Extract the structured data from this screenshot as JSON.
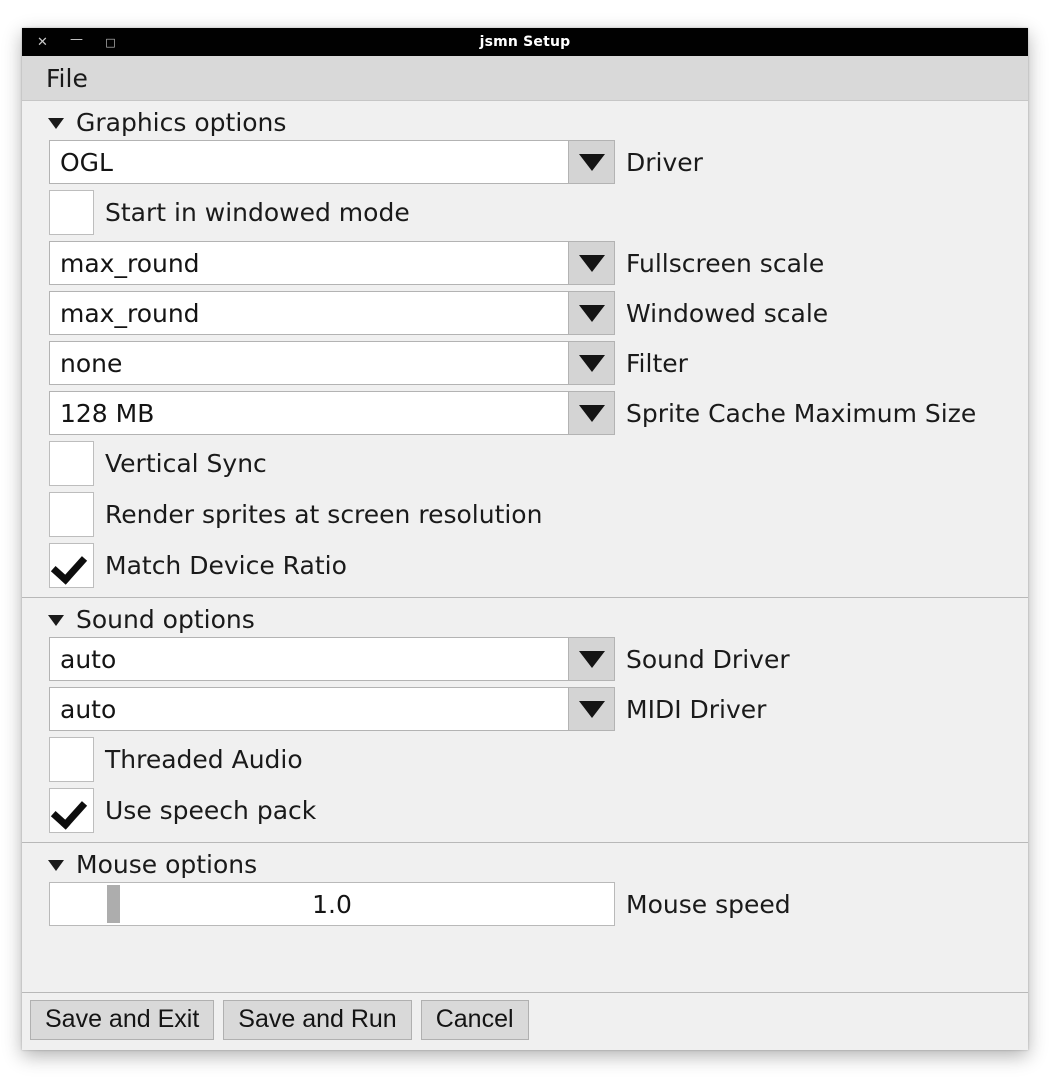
{
  "window": {
    "title": "jsmn Setup",
    "controls": [
      {
        "name": "close",
        "glyph": "✕"
      },
      {
        "name": "minimize",
        "glyph": "—"
      },
      {
        "name": "maximize",
        "glyph": "□"
      }
    ]
  },
  "menubar": {
    "items": [
      {
        "label": "File"
      }
    ]
  },
  "sections": [
    {
      "id": "graphics",
      "title": "Graphics options",
      "expanded_icon": "triangle-down-icon"
    },
    {
      "id": "sound",
      "title": "Sound options",
      "expanded_icon": "triangle-down-icon"
    },
    {
      "id": "mouse",
      "title": "Mouse options",
      "expanded_icon": "triangle-down-icon"
    }
  ],
  "graphics": {
    "driver": {
      "value": "OGL",
      "label": "Driver"
    },
    "windowed_mode": {
      "label": "Start in windowed mode",
      "checked": false
    },
    "fullscreen_scale": {
      "value": "max_round",
      "label": "Fullscreen scale"
    },
    "windowed_scale": {
      "value": "max_round",
      "label": "Windowed scale"
    },
    "filter": {
      "value": "none",
      "label": "Filter"
    },
    "sprite_cache": {
      "value": "128 MB",
      "label": "Sprite Cache Maximum Size"
    },
    "vertical_sync": {
      "label": "Vertical Sync",
      "checked": false
    },
    "render_sprites": {
      "label": "Render sprites at screen resolution",
      "checked": false
    },
    "match_device_ratio": {
      "label": "Match Device Ratio",
      "checked": true
    }
  },
  "sound": {
    "sound_driver": {
      "value": "auto",
      "label": "Sound Driver"
    },
    "midi_driver": {
      "value": "auto",
      "label": "MIDI Driver"
    },
    "threaded_audio": {
      "label": "Threaded Audio",
      "checked": false
    },
    "speech_pack": {
      "label": "Use speech pack",
      "checked": true
    }
  },
  "mouse": {
    "speed": {
      "value": "1.0",
      "label": "Mouse speed",
      "min": "0.0",
      "max": "10.0"
    }
  },
  "buttons": {
    "save_and_exit": "Save and Exit",
    "save_and_run": "Save and Run",
    "cancel": "Cancel"
  },
  "colors": {
    "titlebar_bg": "#010101",
    "titlebar_fg": "#ffffff",
    "menubar_bg": "#d9d9d9",
    "content_bg": "#f0f0f0",
    "control_bg": "#ffffff",
    "button_bg": "#d9d9d9",
    "border": "#b3b3b3",
    "text": "#1a1a1a",
    "slider_handle": "#adadad"
  }
}
